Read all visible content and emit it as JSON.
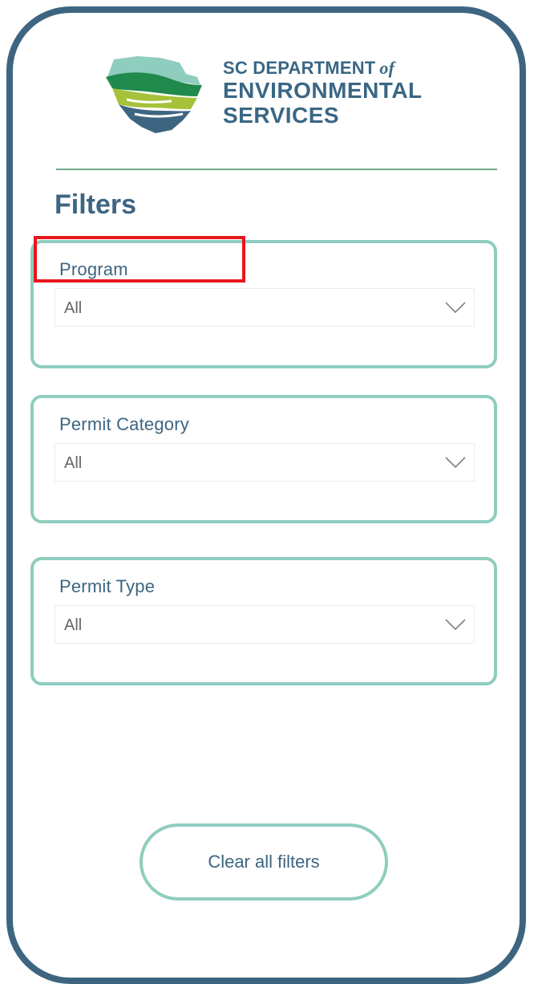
{
  "brand": {
    "line1": "SC DEPARTMENT",
    "line1_suffix": "of",
    "line2": "ENVIRONMENTAL",
    "line3": "SERVICES",
    "colors": {
      "navy": "#3d6581",
      "teal": "#8fcdbf",
      "green": "#1f8a4c",
      "lime": "#a6c23a",
      "highlight": "#e8161c"
    }
  },
  "filters": {
    "title": "Filters",
    "items": [
      {
        "label": "Program",
        "value": "All",
        "icon": "chevron-down-icon"
      },
      {
        "label": "Permit Category",
        "value": "All",
        "icon": "chevron-down-icon"
      },
      {
        "label": "Permit Type",
        "value": "All",
        "icon": "chevron-down-icon"
      }
    ]
  },
  "actions": {
    "clear_label": "Clear all filters"
  }
}
